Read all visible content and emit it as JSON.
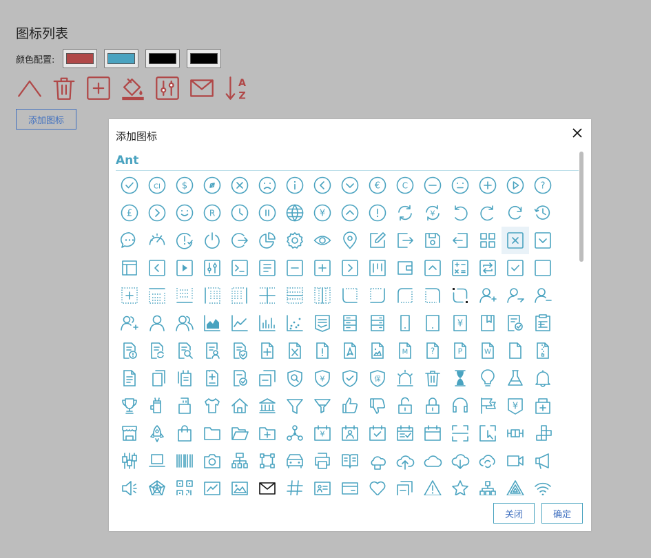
{
  "page_title": "图标列表",
  "color_config": {
    "label": "颜色配置:",
    "swatches": [
      {
        "name": "primary",
        "color": "#b04848"
      },
      {
        "name": "secondary",
        "color": "#4aa3c0"
      },
      {
        "name": "color-3",
        "color": "#000000"
      },
      {
        "name": "color-4",
        "color": "#000000"
      }
    ]
  },
  "selected_icons": [
    "up-icon",
    "delete-icon",
    "plus-square-icon",
    "bg-color-icon",
    "control-icon",
    "mail-icon",
    "sort-az-icon"
  ],
  "add_icon_button": "添加图标",
  "modal": {
    "title": "添加图标",
    "section_title": "Ant",
    "close_button": "关闭",
    "ok_button": "确定",
    "icon_color": "#4aa3c0",
    "highlight_color": "#e9f2f8",
    "highlighted_icon": "close-square-icon",
    "black_icon": "mail-icon",
    "icons": [
      "check-circle-icon",
      "copyright-ci-icon",
      "dollar-circle-icon",
      "compass-icon",
      "close-circle-icon",
      "frown-icon",
      "info-circle-icon",
      "left-circle-icon",
      "down-circle-icon",
      "euro-circle-icon",
      "copyright-circle-icon",
      "minus-circle-icon",
      "meh-icon",
      "plus-circle-icon",
      "play-circle-icon",
      "question-circle-icon",
      "pound-circle-icon",
      "right-circle-icon",
      "smile-icon",
      "trademark-circle-icon",
      "clock-circle-icon",
      "pause-circle-icon",
      "global-icon",
      "yen-circle-icon",
      "up-circle-icon",
      "exclamation-circle-icon",
      "sync-icon",
      "transaction-icon",
      "undo-icon",
      "redo-icon",
      "reload-icon",
      "history-icon",
      "message-icon",
      "dashboard-icon",
      "issues-close-icon",
      "poweroff-icon",
      "logout-icon",
      "pie-chart-icon",
      "setting-icon",
      "eye-icon",
      "location-icon",
      "edit-square-icon",
      "export-icon",
      "save-icon",
      "import-icon",
      "appstore-icon",
      "close-square-icon",
      "down-square-icon",
      "layout-icon",
      "left-square-icon",
      "play-square-icon",
      "control-icon",
      "code-icon",
      "file-text-square-icon",
      "minus-square-icon",
      "plus-square-icon",
      "right-square-icon",
      "project-icon",
      "wallet-icon",
      "up-square-icon",
      "calculator-icon",
      "interaction-icon",
      "check-square-icon",
      "border-icon",
      "border-inner-icon",
      "border-top-icon",
      "border-bottom-icon",
      "border-left-icon",
      "border-right-icon",
      "border-horizontal-icon",
      "border-verticle-icon",
      "border-verticle-2-icon",
      "radius-bottomleft-icon",
      "radius-bottomright-icon",
      "radius-upleft-icon",
      "radius-upright-icon",
      "radius-setting-icon",
      "user-add-icon",
      "user-switch-icon",
      "user-delete-icon",
      "usergroup-add-icon",
      "user-icon",
      "usergroup-icon",
      "area-chart-icon",
      "line-chart-icon",
      "bar-chart-icon",
      "dot-chart-icon",
      "fund-view-icon",
      "database-icon",
      "hdd-icon",
      "mobile-icon",
      "tablet-icon",
      "account-book-icon",
      "book-icon",
      "reconciliation-icon",
      "audit-icon",
      "file-exclamation-icon",
      "file-sync-icon",
      "file-search-icon",
      "solution-icon",
      "file-protect-icon",
      "file-add-icon",
      "file-excel-icon",
      "file-exclamation-2-icon",
      "file-pdf-icon",
      "file-image-icon",
      "file-markdown-icon",
      "file-unknown-icon",
      "file-ppt-icon",
      "file-word-icon",
      "file-icon",
      "file-zip-icon",
      "file-text-icon",
      "copy-icon",
      "snippets-icon",
      "diff-icon",
      "file-done-icon",
      "block-icon",
      "security-scan-icon",
      "property-safety-icon",
      "safety-certificate-icon",
      "insurance-icon",
      "alert-icon",
      "delete-icon",
      "hourglass-icon",
      "bulb-icon",
      "experiment-icon",
      "bell-icon",
      "trophy-icon",
      "rest-icon",
      "usb-icon",
      "skin-icon",
      "home-icon",
      "bank-icon",
      "filter-icon",
      "funnel-plot-icon",
      "like-icon",
      "dislike-icon",
      "unlock-icon",
      "lock-icon",
      "customer-service-icon",
      "flag-icon",
      "money-collect-icon",
      "medicine-box-icon",
      "shop-icon",
      "rocket-icon",
      "shopping-icon",
      "folder-icon",
      "folder-open-icon",
      "folder-add-icon",
      "deployment-unit-icon",
      "account-calendar-icon",
      "contacts-icon",
      "carry-out-icon",
      "calendar-check-icon",
      "calendar-icon",
      "scan-icon",
      "select-icon",
      "box-plot-icon",
      "build-icon",
      "sliders-icon",
      "laptop-icon",
      "barcode-icon",
      "camera-icon",
      "cluster-icon",
      "gateway-icon",
      "car-icon",
      "printer-icon",
      "read-icon",
      "cloud-server-icon",
      "cloud-upload-icon",
      "cloud-icon",
      "cloud-download-icon",
      "cloud-sync-icon",
      "video-camera-icon",
      "notification-icon",
      "sound-icon",
      "radar-chart-icon",
      "qrcode-icon",
      "fund-icon",
      "picture-icon",
      "mail-icon",
      "number-icon",
      "idcard-icon",
      "credit-card-icon",
      "heart-icon",
      "switcher-icon",
      "warning-icon",
      "star-icon",
      "apartment-icon",
      "alert-triangle-icon",
      "wifi-icon"
    ]
  }
}
